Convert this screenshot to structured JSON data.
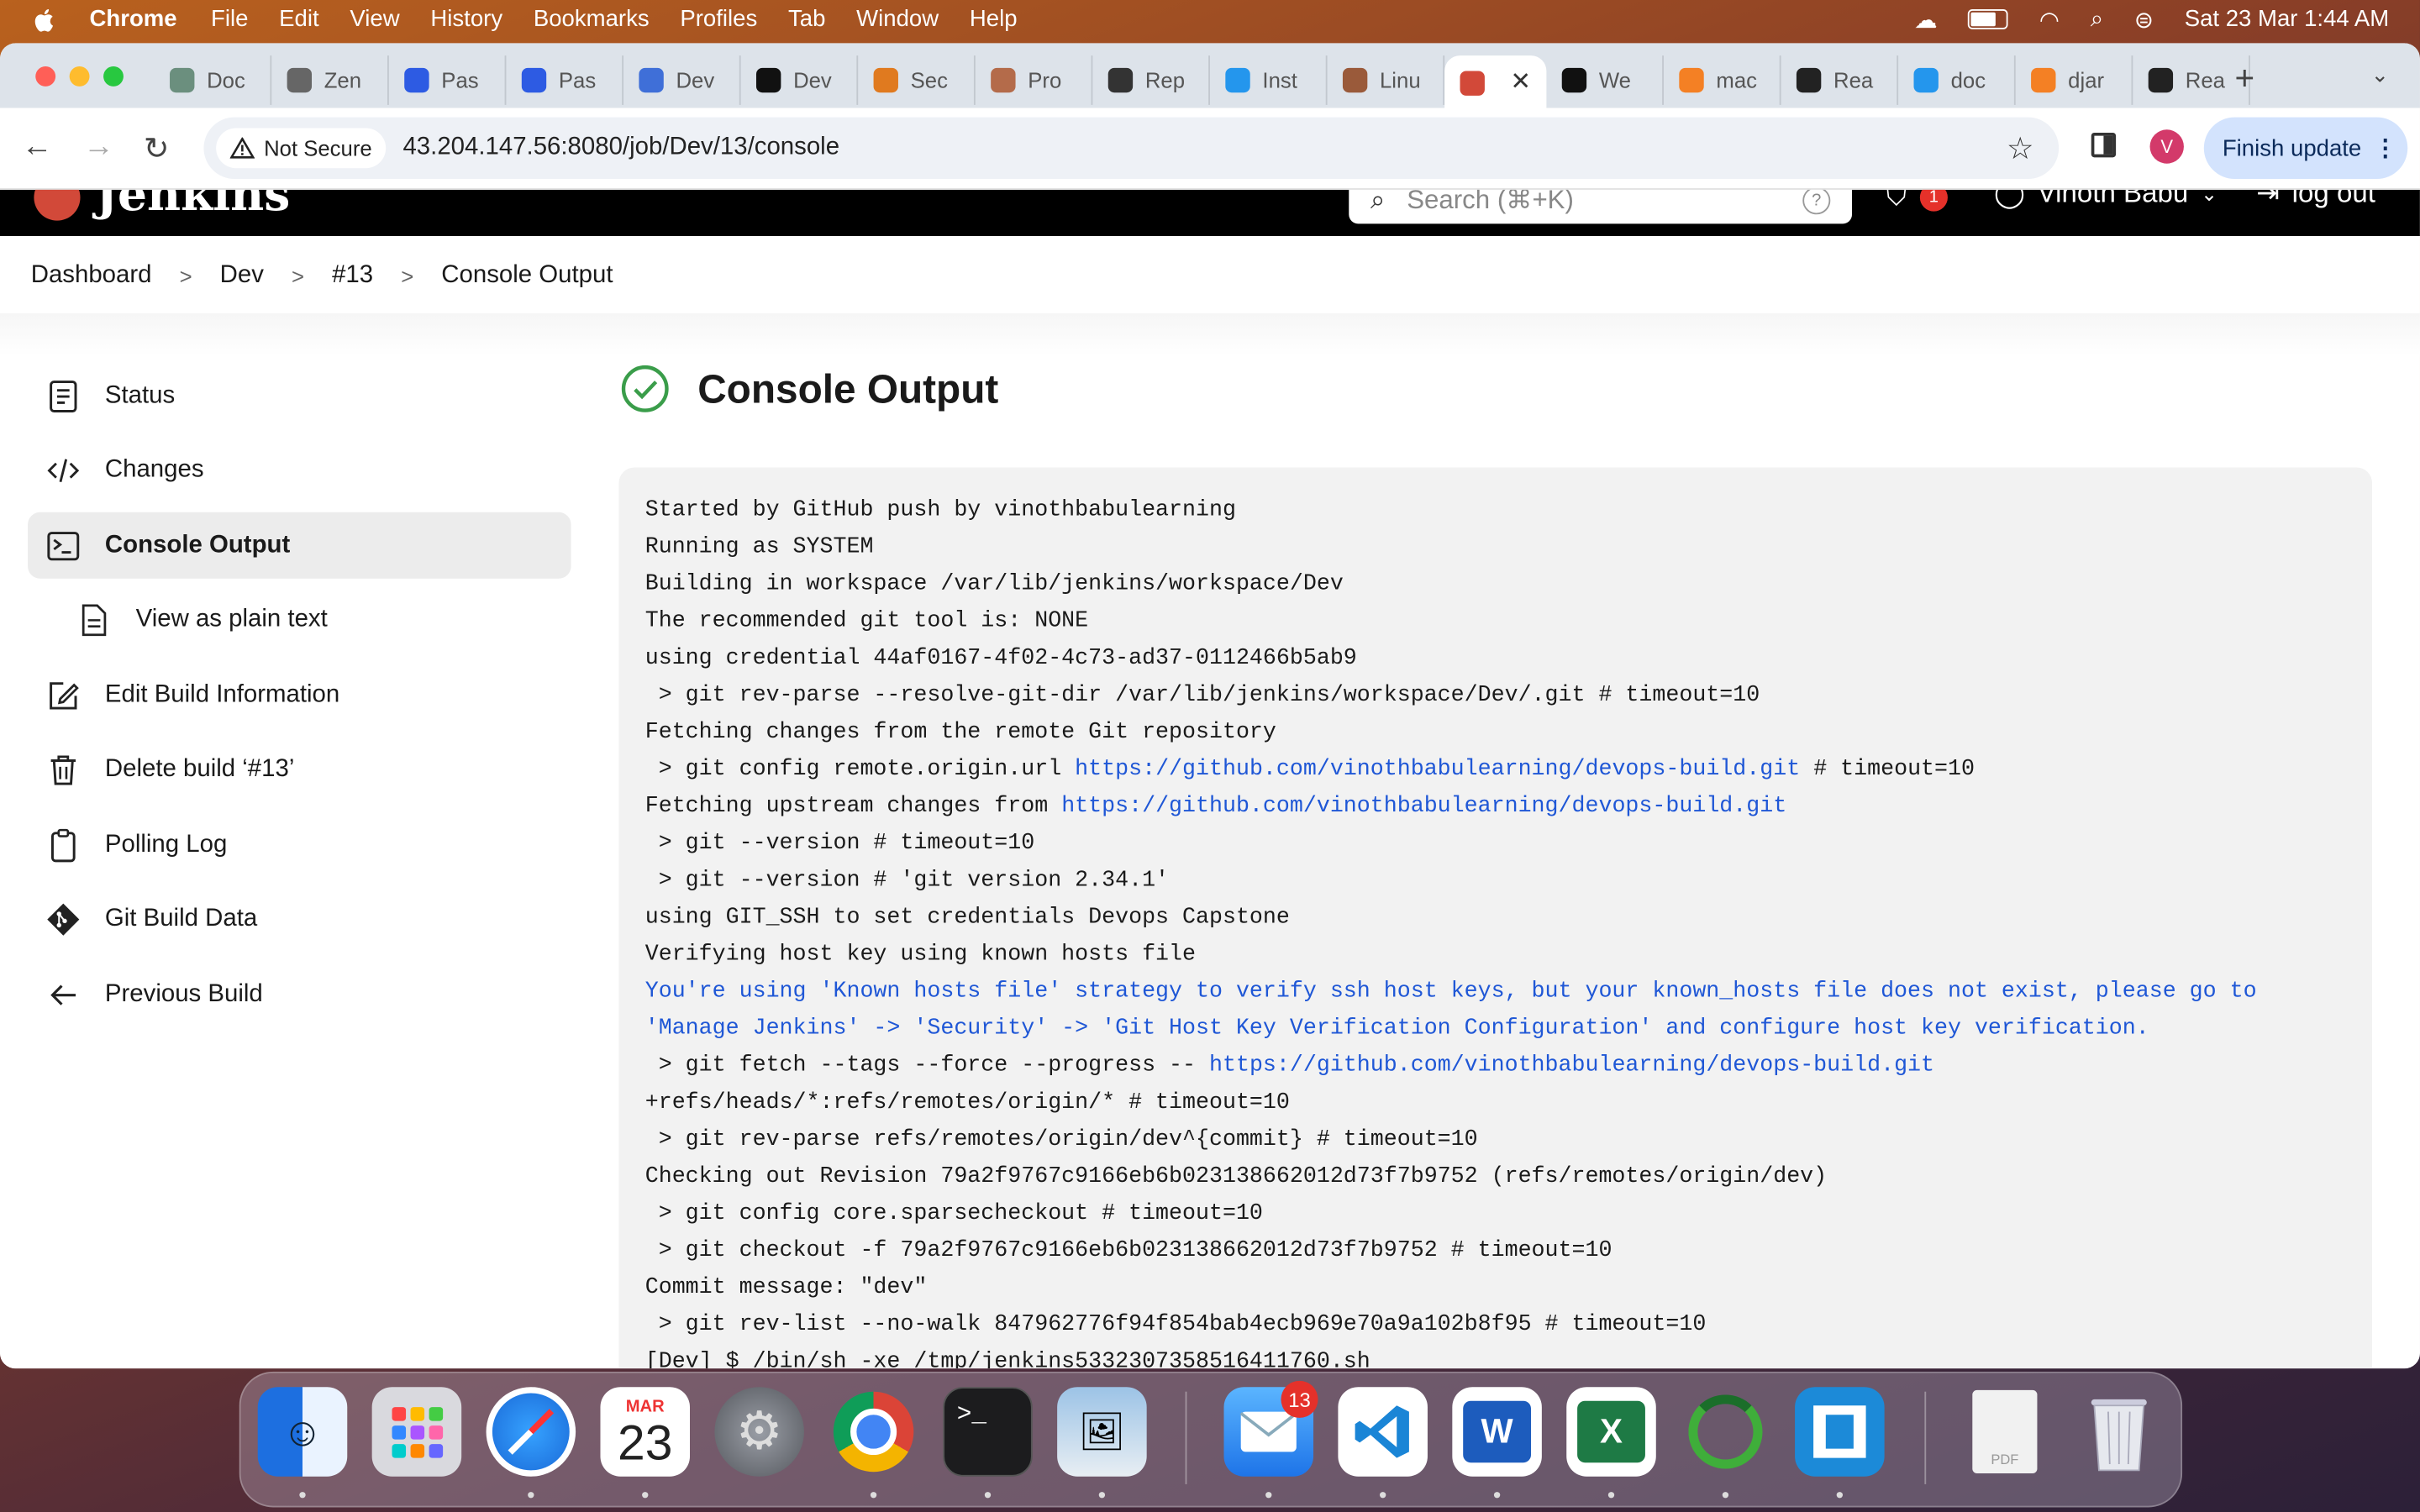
{
  "menubar": {
    "app": "Chrome",
    "items": [
      "File",
      "Edit",
      "View",
      "History",
      "Bookmarks",
      "Profiles",
      "Tab",
      "Window",
      "Help"
    ],
    "datetime": "Sat 23 Mar  1:44 AM"
  },
  "browser": {
    "tabs": [
      {
        "label": "Doc",
        "icon": "chatgpt-icon",
        "color": "#6b8f7e"
      },
      {
        "label": "Zen",
        "icon": "zendesk-icon",
        "color": "#666"
      },
      {
        "label": "Pas",
        "icon": "zm-icon",
        "color": "#2d5be3"
      },
      {
        "label": "Pas",
        "icon": "zm-icon",
        "color": "#2d5be3"
      },
      {
        "label": "Dev",
        "icon": "docs-icon",
        "color": "#3f6fd8"
      },
      {
        "label": "Dev",
        "icon": "medium-icon",
        "color": "#111"
      },
      {
        "label": "Sec",
        "icon": "sec-icon",
        "color": "#e07a1f"
      },
      {
        "label": "Pro",
        "icon": "person-icon",
        "color": "#b46b4a"
      },
      {
        "label": "Rep",
        "icon": "rep-icon",
        "color": "#333"
      },
      {
        "label": "Inst",
        "icon": "docker-icon",
        "color": "#2496ed"
      },
      {
        "label": "Linu",
        "icon": "person-icon",
        "color": "#9a5a3a"
      }
    ],
    "active_tab": {
      "icon": "jenkins-icon",
      "color": "#d24939"
    },
    "tabs_after": [
      {
        "label": "We",
        "icon": "github-icon",
        "color": "#111"
      },
      {
        "label": "mac",
        "icon": "stackoverflow-icon",
        "color": "#f48024"
      },
      {
        "label": "Rea",
        "icon": "react-icon",
        "color": "#222"
      },
      {
        "label": "doc",
        "icon": "docker-icon",
        "color": "#2496ed"
      },
      {
        "label": "djar",
        "icon": "stackoverflow-icon",
        "color": "#f48024"
      },
      {
        "label": "Rea",
        "icon": "react-icon",
        "color": "#222"
      }
    ],
    "not_secure": "Not Secure",
    "url": "43.204.147.56:8080/job/Dev/13/console",
    "profile_initial": "V",
    "finish_update": "Finish update"
  },
  "jenkins": {
    "logo": "Jenkins",
    "search_placeholder": "Search (⌘+K)",
    "security_badge": "1",
    "user": "Vinoth Babu",
    "logout": "log out",
    "breadcrumbs": [
      "Dashboard",
      "Dev",
      "#13",
      "Console Output"
    ],
    "sidebar": [
      {
        "label": "Status",
        "icon": "status-icon"
      },
      {
        "label": "Changes",
        "icon": "code-icon"
      },
      {
        "label": "Console Output",
        "icon": "terminal-icon",
        "active": true
      },
      {
        "label": "View as plain text",
        "icon": "document-icon",
        "sub": true
      },
      {
        "label": "Edit Build Information",
        "icon": "edit-icon"
      },
      {
        "label": "Delete build ‘#13’",
        "icon": "trash-icon"
      },
      {
        "label": "Polling Log",
        "icon": "clipboard-icon"
      },
      {
        "label": "Git Build Data",
        "icon": "git-icon"
      },
      {
        "label": "Previous Build",
        "icon": "arrow-left-icon"
      }
    ],
    "title": "Console Output",
    "console_lines": [
      {
        "parts": [
          {
            "t": "Started by GitHub push by vinothbabulearning"
          }
        ]
      },
      {
        "parts": [
          {
            "t": "Running as SYSTEM"
          }
        ]
      },
      {
        "parts": [
          {
            "t": "Building in workspace /var/lib/jenkins/workspace/Dev"
          }
        ]
      },
      {
        "parts": [
          {
            "t": "The recommended git tool is: NONE"
          }
        ]
      },
      {
        "parts": [
          {
            "t": "using credential 44af0167-4f02-4c73-ad37-0112466b5ab9"
          }
        ]
      },
      {
        "parts": [
          {
            "t": " > git rev-parse --resolve-git-dir /var/lib/jenkins/workspace/Dev/.git # timeout=10"
          }
        ]
      },
      {
        "parts": [
          {
            "t": "Fetching changes from the remote Git repository"
          }
        ]
      },
      {
        "parts": [
          {
            "t": " > git config remote.origin.url "
          },
          {
            "t": "https://github.com/vinothbabulearning/devops-build.git",
            "link": true
          },
          {
            "t": " # timeout=10"
          }
        ]
      },
      {
        "parts": [
          {
            "t": "Fetching upstream changes from "
          },
          {
            "t": "https://github.com/vinothbabulearning/devops-build.git",
            "link": true
          }
        ]
      },
      {
        "parts": [
          {
            "t": " > git --version # timeout=10"
          }
        ]
      },
      {
        "parts": [
          {
            "t": " > git --version # 'git version 2.34.1'"
          }
        ]
      },
      {
        "parts": [
          {
            "t": "using GIT_SSH to set credentials Devops Capstone"
          }
        ]
      },
      {
        "parts": [
          {
            "t": "Verifying host key using known hosts file"
          }
        ]
      },
      {
        "parts": [
          {
            "t": "You're using 'Known hosts file' strategy to verify ssh host keys, but your known_hosts file does not exist, please go to",
            "warn": true
          }
        ]
      },
      {
        "parts": [
          {
            "t": "'Manage Jenkins' -> 'Security' -> 'Git Host Key Verification Configuration' and configure host key verification.",
            "warn": true
          }
        ]
      },
      {
        "parts": [
          {
            "t": " > git fetch --tags --force --progress -- "
          },
          {
            "t": "https://github.com/vinothbabulearning/devops-build.git",
            "link": true
          }
        ]
      },
      {
        "parts": [
          {
            "t": "+refs/heads/*:refs/remotes/origin/* # timeout=10"
          }
        ]
      },
      {
        "parts": [
          {
            "t": " > git rev-parse refs/remotes/origin/dev^{commit} # timeout=10"
          }
        ]
      },
      {
        "parts": [
          {
            "t": "Checking out Revision 79a2f9767c9166eb6b023138662012d73f7b9752 (refs/remotes/origin/dev)"
          }
        ]
      },
      {
        "parts": [
          {
            "t": " > git config core.sparsecheckout # timeout=10"
          }
        ]
      },
      {
        "parts": [
          {
            "t": " > git checkout -f 79a2f9767c9166eb6b023138662012d73f7b9752 # timeout=10"
          }
        ]
      },
      {
        "parts": [
          {
            "t": "Commit message: \"dev\""
          }
        ]
      },
      {
        "parts": [
          {
            "t": " > git rev-list --no-walk 847962776f94f854bab4ecb969e70a9a102b8f95 # timeout=10"
          }
        ]
      },
      {
        "parts": [
          {
            "t": "[Dev] $ /bin/sh -xe /tmp/jenkins5332307358516411760.sh"
          }
        ]
      }
    ]
  },
  "dock": {
    "calendar_month": "MAR",
    "calendar_day": "23",
    "mail_badge": "13",
    "apps": [
      "finder-icon",
      "launchpad-icon",
      "safari-icon",
      "calendar-icon",
      "system-settings-icon",
      "chrome-icon",
      "terminal-icon",
      "preview-icon",
      "mail-icon",
      "vscode-icon",
      "word-icon",
      "excel-icon",
      "circle-app-icon",
      "bracket-app-icon",
      "pdf-icon",
      "trash-icon"
    ]
  }
}
